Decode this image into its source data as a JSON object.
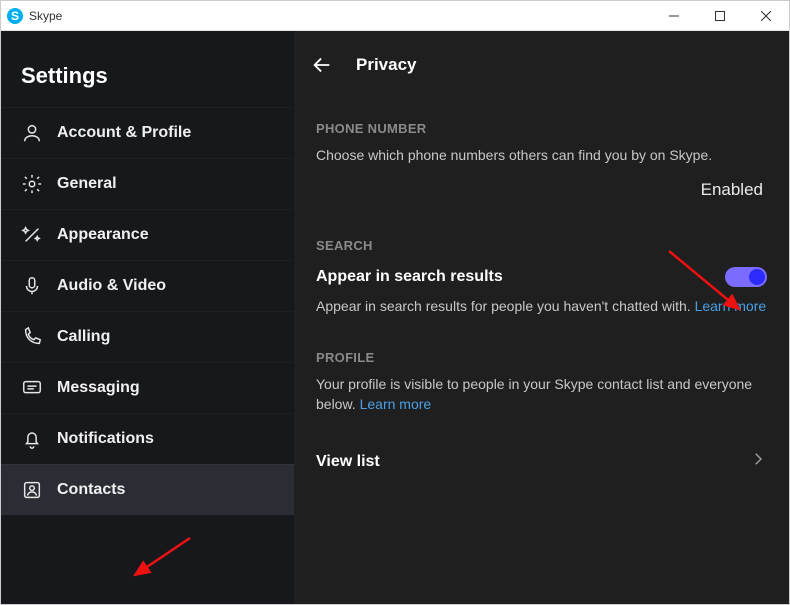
{
  "window": {
    "title": "Skype"
  },
  "sidebar": {
    "heading": "Settings",
    "items": [
      {
        "label": "Account & Profile",
        "icon": "person"
      },
      {
        "label": "General",
        "icon": "gear"
      },
      {
        "label": "Appearance",
        "icon": "wand"
      },
      {
        "label": "Audio & Video",
        "icon": "mic"
      },
      {
        "label": "Calling",
        "icon": "phone"
      },
      {
        "label": "Messaging",
        "icon": "message"
      },
      {
        "label": "Notifications",
        "icon": "bell"
      },
      {
        "label": "Contacts",
        "icon": "contacts"
      }
    ]
  },
  "main": {
    "title": "Privacy",
    "phone": {
      "section_label": "PHONE NUMBER",
      "desc": "Choose which phone numbers others can find you by on Skype.",
      "status": "Enabled"
    },
    "search": {
      "section_label": "SEARCH",
      "toggle_label": "Appear in search results",
      "toggle_on": true,
      "desc_prefix": "Appear in search results for people you haven't chatted with. ",
      "learn_more": "Learn more"
    },
    "profile": {
      "section_label": "PROFILE",
      "desc_prefix": "Your profile is visible to people in your Skype contact list and everyone below. ",
      "learn_more": "Learn more",
      "view_list_label": "View list"
    }
  }
}
